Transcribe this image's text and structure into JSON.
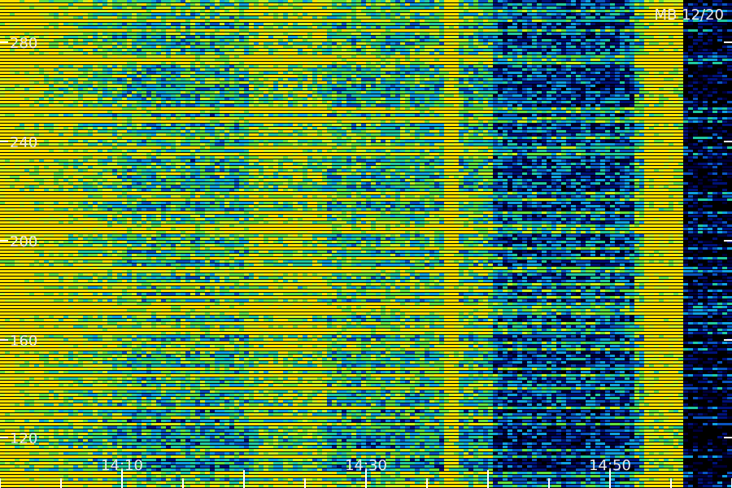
{
  "chart_data": {
    "type": "heatmap",
    "title": "MB 12/20",
    "xlabel": "",
    "ylabel": "",
    "x_ticks": [
      "14:10",
      "14:30",
      "14:50"
    ],
    "y_ticks": [
      "280",
      "240",
      "200",
      "160",
      "120"
    ],
    "colormap": [
      "#000010",
      "#00003a",
      "#00127a",
      "#0a55c0",
      "#10a0e0",
      "#20c8a0",
      "#60e040",
      "#c8f020",
      "#ffe000",
      "#ff4000"
    ],
    "grid": false
  }
}
